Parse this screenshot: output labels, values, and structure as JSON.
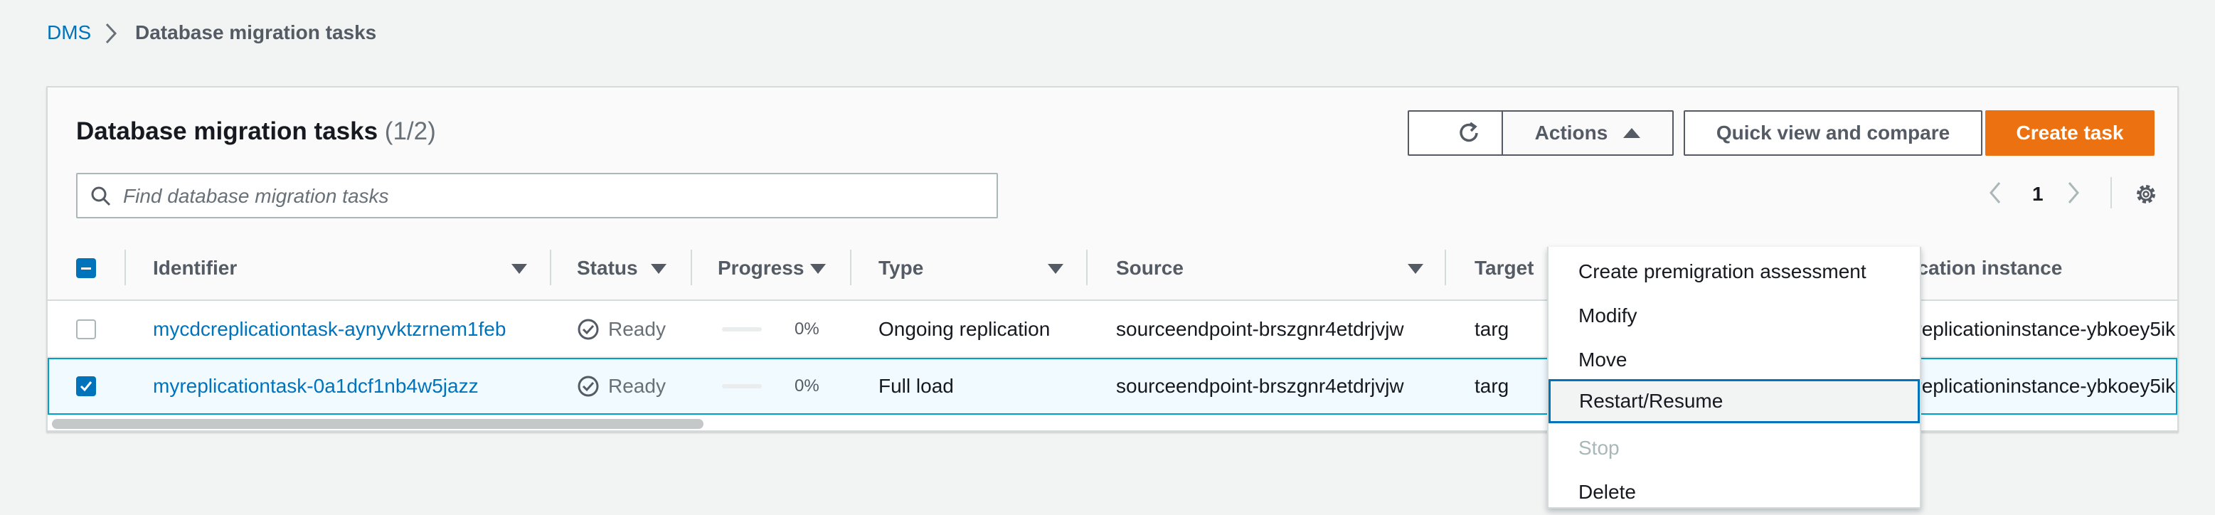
{
  "breadcrumb": {
    "root": "DMS",
    "current": "Database migration tasks"
  },
  "panel": {
    "title": "Database migration tasks",
    "count": "(1/2)",
    "search_placeholder": "Find database migration tasks"
  },
  "toolbar": {
    "actions_label": "Actions",
    "quick_view_label": "Quick view and compare",
    "create_label": "Create task"
  },
  "pagination": {
    "current_page": "1"
  },
  "columns": {
    "identifier": "Identifier",
    "status": "Status",
    "progress": "Progress",
    "type": "Type",
    "source": "Source",
    "target": "Target",
    "replication_instance": "Replication instance"
  },
  "rows": [
    {
      "selected": false,
      "identifier": "mycdcreplicationtask-aynyvktzrnem1feb",
      "status": "Ready",
      "progress": "0%",
      "progress_value": 0,
      "type": "Ongoing replication",
      "source": "sourceendpoint-brszgnr4etdrjvjw",
      "target": "targ",
      "replication_instance": "basicreplicationinstance-ybkoey5ik"
    },
    {
      "selected": true,
      "identifier": "myreplicationtask-0a1dcf1nb4w5jazz",
      "status": "Ready",
      "progress": "0%",
      "progress_value": 0,
      "type": "Full load",
      "source": "sourceendpoint-brszgnr4etdrjvjw",
      "target": "targ",
      "replication_instance": "basicreplicationinstance-ybkoey5ik"
    }
  ],
  "actions_menu": [
    {
      "label": "Create premigration assessment",
      "state": "enabled"
    },
    {
      "label": "Modify",
      "state": "enabled"
    },
    {
      "label": "Move",
      "state": "enabled"
    },
    {
      "label": "Restart/Resume",
      "state": "highlighted"
    },
    {
      "label": "Stop",
      "state": "disabled"
    },
    {
      "label": "Delete",
      "state": "enabled"
    }
  ],
  "colors": {
    "link": "#0073bb",
    "primary_button": "#ec7211",
    "selected_row_border": "#00a1c9",
    "disabled_text": "#aab7b8"
  },
  "icons": [
    "chevron-right-icon",
    "refresh-icon",
    "caret-up-icon",
    "search-icon",
    "chevron-left-icon",
    "gear-icon",
    "sort-caret-icon",
    "check-circle-icon"
  ]
}
